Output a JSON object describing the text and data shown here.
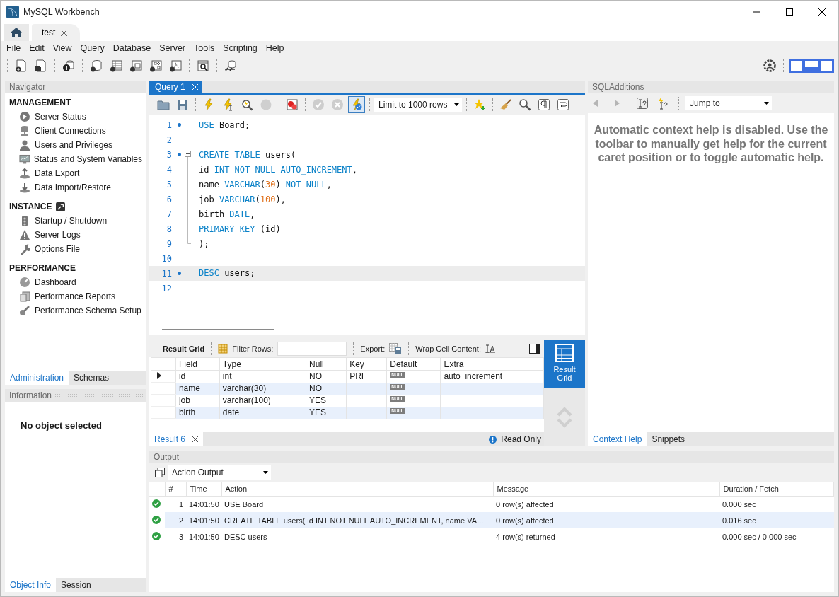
{
  "window": {
    "title": "MySQL Workbench"
  },
  "connection_tabs": [
    {
      "label": "test",
      "selected": true
    }
  ],
  "menu": [
    "File",
    "Edit",
    "View",
    "Query",
    "Database",
    "Server",
    "Tools",
    "Scripting",
    "Help"
  ],
  "navigator": {
    "title": "Navigator",
    "sections": [
      {
        "title": "MANAGEMENT",
        "items": [
          "Server Status",
          "Client Connections",
          "Users and Privileges",
          "Status and System Variables",
          "Data Export",
          "Data Import/Restore"
        ]
      },
      {
        "title": "INSTANCE",
        "items": [
          "Startup / Shutdown",
          "Server Logs",
          "Options File"
        ]
      },
      {
        "title": "PERFORMANCE",
        "items": [
          "Dashboard",
          "Performance Reports",
          "Performance Schema Setup"
        ]
      }
    ],
    "tabs": [
      {
        "label": "Administration",
        "selected": true
      },
      {
        "label": "Schemas",
        "selected": false
      }
    ]
  },
  "information": {
    "title": "Information",
    "message": "No object selected",
    "tabs": [
      {
        "label": "Object Info",
        "selected": true
      },
      {
        "label": "Session",
        "selected": false
      }
    ]
  },
  "query_tabs": [
    {
      "label": "Query 1",
      "selected": true
    }
  ],
  "editor_toolbar": {
    "limit": "Limit to 1000 rows",
    "autocommit": true
  },
  "editor": {
    "lines": [
      {
        "number": "1",
        "dot": true,
        "current": false,
        "kind": "plain",
        "tokens": [
          {
            "kind": "keyword",
            "text": "USE"
          },
          {
            "kind": "text",
            "text": " Board;"
          }
        ]
      },
      {
        "number": "2",
        "dot": false,
        "current": false,
        "kind": "plain"
      },
      {
        "number": "3",
        "dot": true,
        "current": false,
        "kind": "foldstart",
        "tokens": [
          {
            "kind": "keyword",
            "text": "CREATE TABLE"
          },
          {
            "kind": "text",
            "text": " users("
          }
        ]
      },
      {
        "number": "4",
        "dot": false,
        "current": false,
        "kind": "foldbody",
        "tokens": [
          {
            "kind": "text",
            "text": "id "
          },
          {
            "kind": "keyword",
            "text": "INT NOT NULL AUTO_INCREMENT"
          },
          {
            "kind": "text",
            "text": ","
          }
        ]
      },
      {
        "number": "5",
        "dot": false,
        "current": false,
        "kind": "foldbody",
        "tokens": [
          {
            "kind": "text",
            "text": "name "
          },
          {
            "kind": "keyword",
            "text": "VARCHAR"
          },
          {
            "kind": "text",
            "text": "("
          },
          {
            "kind": "number",
            "text": "30"
          },
          {
            "kind": "text",
            "text": ") "
          },
          {
            "kind": "keyword",
            "text": "NOT NULL"
          },
          {
            "kind": "text",
            "text": ","
          }
        ]
      },
      {
        "number": "6",
        "dot": false,
        "current": false,
        "kind": "foldbody",
        "tokens": [
          {
            "kind": "text",
            "text": "job "
          },
          {
            "kind": "keyword",
            "text": "VARCHAR"
          },
          {
            "kind": "text",
            "text": "("
          },
          {
            "kind": "number",
            "text": "100"
          },
          {
            "kind": "text",
            "text": "),"
          }
        ]
      },
      {
        "number": "7",
        "dot": false,
        "current": false,
        "kind": "foldbody",
        "tokens": [
          {
            "kind": "text",
            "text": "birth "
          },
          {
            "kind": "keyword",
            "text": "DATE"
          },
          {
            "kind": "text",
            "text": ","
          }
        ]
      },
      {
        "number": "8",
        "dot": false,
        "current": false,
        "kind": "foldbody",
        "tokens": [
          {
            "kind": "keyword",
            "text": "PRIMARY KEY"
          },
          {
            "kind": "text",
            "text": " (id)"
          }
        ]
      },
      {
        "number": "9",
        "dot": false,
        "current": false,
        "kind": "foldend",
        "tokens": [
          {
            "kind": "text",
            "text": ");"
          }
        ]
      },
      {
        "number": "10",
        "dot": false,
        "current": false,
        "kind": "plain"
      },
      {
        "number": "11",
        "dot": true,
        "current": true,
        "kind": "plain",
        "tokens": [
          {
            "kind": "keyword",
            "text": "DESC"
          },
          {
            "kind": "text",
            "text": " users;"
          }
        ]
      },
      {
        "number": "12",
        "dot": false,
        "current": false,
        "kind": "plain"
      }
    ]
  },
  "result_toolbar": {
    "view_label": "Result Grid",
    "filter_label": "Filter Rows:",
    "export_label": "Export:",
    "wrap_label": "Wrap Cell Content:"
  },
  "result_grid": {
    "columns": [
      "Field",
      "Type",
      "Null",
      "Key",
      "Default",
      "Extra"
    ],
    "rows": [
      {
        "selected": true,
        "cells": [
          {
            "kind": "text",
            "text": "id"
          },
          {
            "kind": "text",
            "text": "int"
          },
          {
            "kind": "text",
            "text": "NO"
          },
          {
            "kind": "text",
            "text": "PRI"
          },
          {
            "kind": "null",
            "text": "NULL"
          },
          {
            "kind": "text",
            "text": "auto_increment"
          }
        ]
      },
      {
        "selected": false,
        "cells": [
          {
            "kind": "text",
            "text": "name"
          },
          {
            "kind": "text",
            "text": "varchar(30)"
          },
          {
            "kind": "text",
            "text": "NO"
          },
          null,
          {
            "kind": "null",
            "text": "NULL"
          },
          null
        ]
      },
      {
        "selected": false,
        "cells": [
          {
            "kind": "text",
            "text": "job"
          },
          {
            "kind": "text",
            "text": "varchar(100)"
          },
          {
            "kind": "text",
            "text": "YES"
          },
          null,
          {
            "kind": "null",
            "text": "NULL"
          },
          null
        ]
      },
      {
        "selected": false,
        "cells": [
          {
            "kind": "text",
            "text": "birth"
          },
          {
            "kind": "text",
            "text": "date"
          },
          {
            "kind": "text",
            "text": "YES"
          },
          null,
          {
            "kind": "null",
            "text": "NULL"
          },
          null
        ]
      }
    ]
  },
  "result_side": {
    "label": "Result Grid",
    "selected": true
  },
  "result_tabs": [
    {
      "label": "Result 6",
      "selected": true
    }
  ],
  "result_status": "Read Only",
  "sql_additions": {
    "title": "SQLAdditions",
    "jump_to": "Jump to",
    "help": "Automatic context help is disabled. Use the toolbar to manually get help for the current caret position or to toggle automatic help.",
    "tabs": [
      {
        "label": "Context Help",
        "selected": true
      },
      {
        "label": "Snippets",
        "selected": false
      }
    ]
  },
  "output": {
    "title": "Output",
    "mode": "Action Output",
    "columns": [
      "#",
      "Time",
      "Action",
      "Message",
      "Duration / Fetch"
    ],
    "rows": [
      {
        "kind": "success",
        "number": "1",
        "time": "14:01:50",
        "action": "USE Board",
        "message": "0 row(s) affected",
        "duration": "0.000 sec"
      },
      {
        "kind": "success",
        "number": "2",
        "time": "14:01:50",
        "action": "CREATE TABLE users( id INT NOT NULL AUTO_INCREMENT, name VA...",
        "message": "0 row(s) affected",
        "duration": "0.016 sec"
      },
      {
        "kind": "success",
        "number": "3",
        "time": "14:01:50",
        "action": "DESC users",
        "message": "4 row(s) returned",
        "duration": "0.000 sec / 0.000 sec"
      }
    ]
  }
}
